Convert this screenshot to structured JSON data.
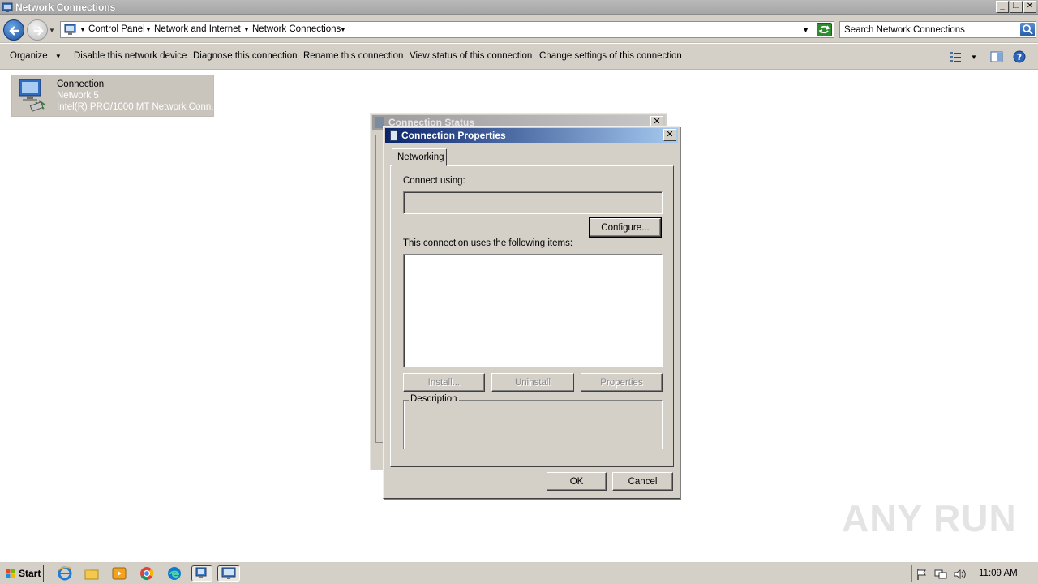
{
  "window": {
    "title": "Network Connections"
  },
  "address": {
    "crumbs": [
      "Control Panel",
      "Network and Internet",
      "Network Connections"
    ],
    "search_placeholder": "Search Network Connections"
  },
  "toolbar": {
    "organize": "Organize",
    "disable": "Disable this network device",
    "diagnose": "Diagnose this connection",
    "rename": "Rename this connection",
    "view_status": "View status of this connection",
    "change_settings": "Change settings of this connection"
  },
  "connection": {
    "name": "Connection",
    "network": "Network  5",
    "adapter": "Intel(R) PRO/1000 MT Network Conn..."
  },
  "status_dialog": {
    "title": "Connection Status"
  },
  "properties_dialog": {
    "title": "Connection Properties",
    "tab": "Networking",
    "connect_using_label": "Connect using:",
    "configure": "Configure...",
    "items_label": "This connection uses the following items:",
    "install": "Install...",
    "uninstall": "Uninstall",
    "properties": "Properties",
    "description_label": "Description",
    "ok": "OK",
    "cancel": "Cancel"
  },
  "watermark": "ANY RUN",
  "taskbar": {
    "start": "Start",
    "clock": "11:09 AM"
  },
  "icons": {
    "back": "back-arrow-icon",
    "forward": "forward-arrow-icon",
    "refresh": "refresh-icon",
    "search": "search-icon",
    "help": "help-icon",
    "network": "network-connection-icon"
  }
}
